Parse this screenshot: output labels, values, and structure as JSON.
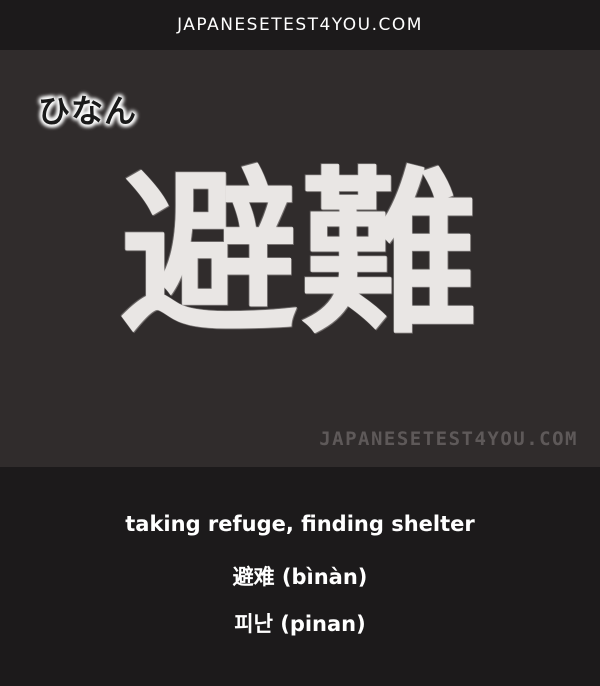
{
  "header": {
    "site_name": "JAPANESETEST4YOU.COM"
  },
  "card": {
    "reading": "ひなん",
    "kanji": "避難",
    "watermark": "JAPANESETEST4YOU.COM"
  },
  "translations": {
    "english": "taking refuge, finding shelter",
    "chinese": "避难 (bìnàn)",
    "korean": "피난 (pinan)"
  },
  "colors": {
    "background": "#1c1a1b",
    "board": "#302c2c",
    "text": "#ffffff",
    "watermark": "#5e5959"
  }
}
